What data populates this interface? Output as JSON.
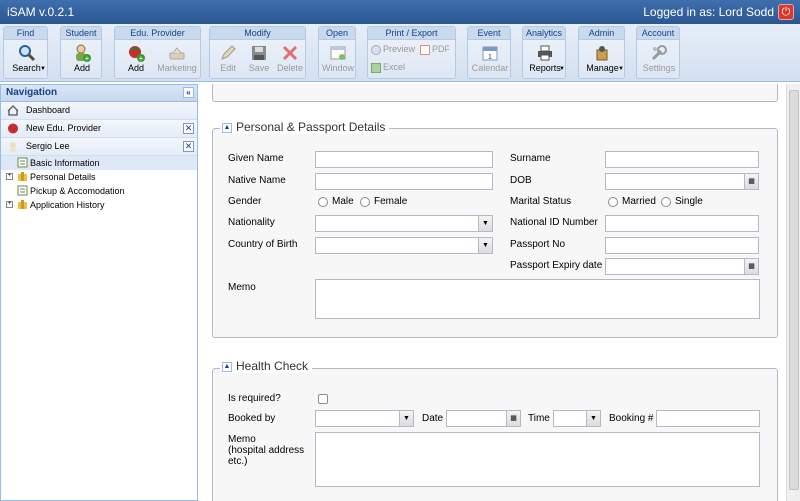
{
  "app": {
    "title": "iSAM v.0.2.1",
    "login": "Logged in as: Lord Sodd"
  },
  "toolbar": {
    "find": {
      "title": "Find",
      "search": "Search"
    },
    "student": {
      "title": "Student",
      "add": "Add"
    },
    "provider": {
      "title": "Edu. Provider",
      "add": "Add",
      "marketing": "Marketing"
    },
    "modify": {
      "title": "Modify",
      "edit": "Edit",
      "save": "Save",
      "delete": "Delete"
    },
    "open": {
      "title": "Open",
      "window": "Window"
    },
    "print": {
      "title": "Print / Export",
      "preview": "Preview",
      "pdf": "PDF",
      "excel": "Excel"
    },
    "event": {
      "title": "Event",
      "calendar": "Calendar"
    },
    "analytics": {
      "title": "Analytics",
      "reports": "Reports"
    },
    "admin": {
      "title": "Admin",
      "manage": "Manage"
    },
    "account": {
      "title": "Account",
      "settings": "Settings"
    }
  },
  "nav": {
    "title": "Navigation",
    "items": [
      {
        "label": "Dashboard"
      },
      {
        "label": "New Edu. Provider"
      },
      {
        "label": "Sergio Lee"
      }
    ],
    "tree": [
      {
        "label": "Basic Information"
      },
      {
        "label": "Personal Details"
      },
      {
        "label": "Pickup & Accomodation"
      },
      {
        "label": "Application History"
      }
    ]
  },
  "personal": {
    "legend": "Personal & Passport Details",
    "given_name": "Given Name",
    "native_name": "Native Name",
    "gender": "Gender",
    "male": "Male",
    "female": "Female",
    "nationality": "Nationality",
    "country_birth": "Country of Birth",
    "memo": "Memo",
    "surname": "Surname",
    "dob": "DOB",
    "marital": "Marital Status",
    "married": "Married",
    "single": "Single",
    "national_id": "National ID Number",
    "passport_no": "Passport No",
    "passport_expiry": "Passport Expiry date"
  },
  "health": {
    "legend": "Health Check",
    "required": "Is required?",
    "booked_by": "Booked by",
    "date": "Date",
    "time": "Time",
    "booking": "Booking #",
    "memo1": "Memo",
    "memo2": "(hospital address",
    "memo3": "etc.)"
  }
}
